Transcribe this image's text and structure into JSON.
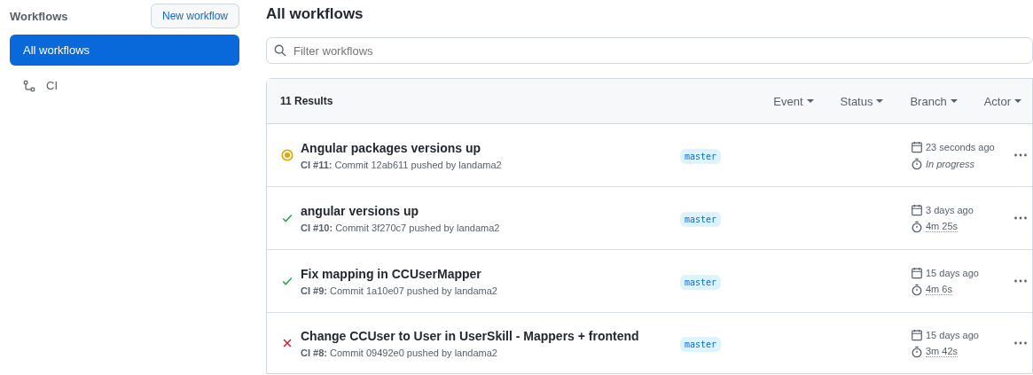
{
  "sidebar": {
    "title": "Workflows",
    "new_button": "New workflow",
    "items": [
      {
        "label": "All workflows",
        "selected": true,
        "kind": "all"
      },
      {
        "label": "CI",
        "selected": false,
        "kind": "workflow"
      }
    ]
  },
  "main": {
    "title": "All workflows",
    "search": {
      "placeholder": "Filter workflows"
    },
    "results": "11 Results",
    "filters": [
      "Event",
      "Status",
      "Branch",
      "Actor"
    ],
    "runs": [
      {
        "kind": "in_progress",
        "title": "Angular packages versions up",
        "subtitle": "**CI #11:** Commit 12ab611 pushed by landama2",
        "branch": "master",
        "time": "23 seconds ago",
        "duration": "In progress"
      },
      {
        "kind": "success",
        "title": "angular versions up",
        "subtitle": "**CI #10:** Commit 3f270c7 pushed by landama2",
        "branch": "master",
        "time": "3 days ago",
        "duration": "4m 25s"
      },
      {
        "kind": "success",
        "title": "Fix mapping in CCUserMapper",
        "subtitle": "**CI #9:** Commit 1a10e07 pushed by landama2",
        "branch": "master",
        "time": "15 days ago",
        "duration": "4m 6s"
      },
      {
        "kind": "failure",
        "title": "Change CCUser to User in UserSkill - Mappers + frontend",
        "subtitle": "**CI #8:** Commit 09492e0 pushed by landama2",
        "branch": "master",
        "time": "15 days ago",
        "duration": "3m 42s"
      }
    ]
  }
}
